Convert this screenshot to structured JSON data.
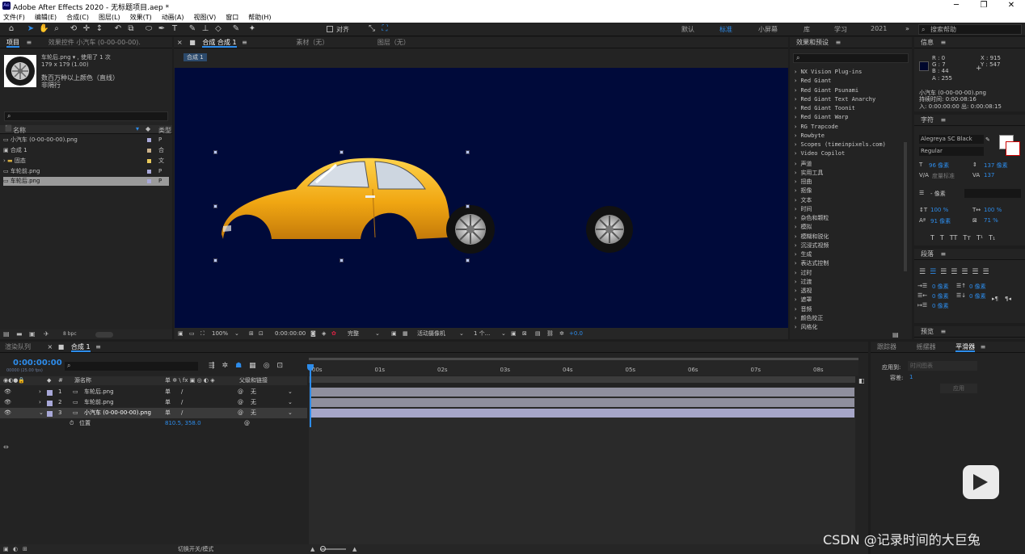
{
  "window": {
    "title": "Adobe After Effects 2020 - 无标题项目.aep *",
    "logo_text": "Ae",
    "controls": [
      "─",
      "❐",
      "✕"
    ]
  },
  "menu": [
    "文件(F)",
    "编辑(E)",
    "合成(C)",
    "图层(L)",
    "效果(T)",
    "动画(A)",
    "视图(V)",
    "窗口",
    "帮助(H)"
  ],
  "toolbar": {
    "snap_label": "对齐",
    "workspaces": [
      "默认",
      "标准",
      "小屏幕",
      "库",
      "学习",
      "2021"
    ],
    "active_workspace": "标准",
    "search_placeholder": "搜索帮助"
  },
  "project_panel": {
    "tab_project": "项目",
    "tab_effects": "效果控件 小汽车 (0-00-00-00).",
    "preview_name": "车轮后.png ▾ , 使用了 1 次",
    "preview_size": "179 x 179 (1.00)",
    "preview_colors": "数百万种以上颜色（直线）",
    "preview_interlace": "非隔行",
    "search_placeholder": "",
    "col_name": "名称",
    "col_type": "类型",
    "items": [
      {
        "name": "小汽车 (0-00-00-00).png",
        "type": "P"
      },
      {
        "name": "合成 1",
        "type": "合"
      },
      {
        "name": "固态",
        "type": "文"
      },
      {
        "name": "车轮前.png",
        "type": "P"
      },
      {
        "name": "车轮后.png",
        "type": "P"
      }
    ],
    "bpc": "8 bpc"
  },
  "comp_panel": {
    "tab_comp": "合成 合成 1",
    "tab_footage": "素材（无）",
    "tab_layer": "图层（无）",
    "breadcrumb": "合成 1",
    "zoom": "100%",
    "timecode": "0:00:00:00",
    "quality": "完整",
    "camera": "活动摄像机",
    "views": "1 个...",
    "exposure": "+0.0"
  },
  "effects_panel": {
    "title": "效果和预设",
    "items": [
      "NX Vision Plug-ins",
      "Red Giant",
      "Red Giant Psunami",
      "Red Giant Text Anarchy",
      "Red Giant Toonit",
      "Red Giant Warp",
      "RG Trapcode",
      "Rowbyte",
      "Scopes (timeinpixels.com)",
      "Video Copilot",
      "声道",
      "实用工具",
      "扭曲",
      "抠像",
      "文本",
      "时间",
      "杂色和颗粒",
      "模拟",
      "模糊和锐化",
      "沉浸式视频",
      "生成",
      "表达式控制",
      "过时",
      "过渡",
      "透视",
      "遮罩",
      "音频",
      "颜色校正",
      "风格化"
    ]
  },
  "info_panel": {
    "title": "信息",
    "r": "R : 0",
    "g": "G : 7",
    "b": "B : 44",
    "a": "A : 255",
    "x": "X : 915",
    "y": "Y : 547",
    "layer_name": "小汽车 (0-00-00-00).png",
    "duration": "持续时间: 0:00:08:16",
    "in_out": "入: 0:00:00:00   出: 0:00:08:15",
    "swatch": "#00072c"
  },
  "character_panel": {
    "title": "字符",
    "font": "Alegreya SC Black",
    "style": "Regular",
    "size": "96 像素",
    "leading": "137 像素",
    "kerning": "度量标准",
    "tracking": "137",
    "stroke": "- 像素",
    "vscale": "100 %",
    "hscale": "100 %",
    "baseline": "91 像素",
    "tsume": "71 %",
    "styles": [
      "T",
      "T",
      "TT",
      "Tт",
      "T¹",
      "T₁"
    ]
  },
  "paragraph_panel": {
    "title": "段落",
    "indent_left": "0 像素",
    "indent_right": "0 像素",
    "space_before": "0 像素",
    "space_after": "0 像素",
    "first_line": "0 像素"
  },
  "preview_panel": {
    "title": "预览"
  },
  "timeline": {
    "tab_render": "渲染队列",
    "tab_comp": "合成 1",
    "timecode": "0:00:00:00",
    "timecode_sub": "00000 (25.00 fps)",
    "col_source": "源名称",
    "col_switches": "单 ✲ \\ fx ▣ ◎ ◐ ◈",
    "col_parent": "父级和链接",
    "layers": [
      {
        "num": "1",
        "name": "车轮后.png",
        "parent": "无"
      },
      {
        "num": "2",
        "name": "车轮前.png",
        "parent": "无"
      },
      {
        "num": "3",
        "name": "小汽车 (0-00-00-00).png",
        "parent": "无"
      }
    ],
    "property_name": "位置",
    "property_value": "810.5, 358.0",
    "ticks": [
      "00s",
      "01s",
      "02s",
      "03s",
      "04s",
      "05s",
      "06s",
      "07s",
      "08s"
    ],
    "footer": "切换开关/模式"
  },
  "align_panel": {
    "tab_align": "跟踪器",
    "tab_wiggler": "摇摆器",
    "tab_smoother": "平滑器",
    "apply_to": "应用到:",
    "apply_to_value": "时间图表",
    "tolerance": "容差:",
    "tolerance_value": "1",
    "apply": "应用"
  },
  "watermark": "CSDN @记录时间的大巨兔",
  "colors": {
    "accent": "#2d8ceb",
    "viewer_bg": "#000a3a",
    "car_body": "#f3b21a",
    "label_lavender": "#a8a8d8"
  }
}
